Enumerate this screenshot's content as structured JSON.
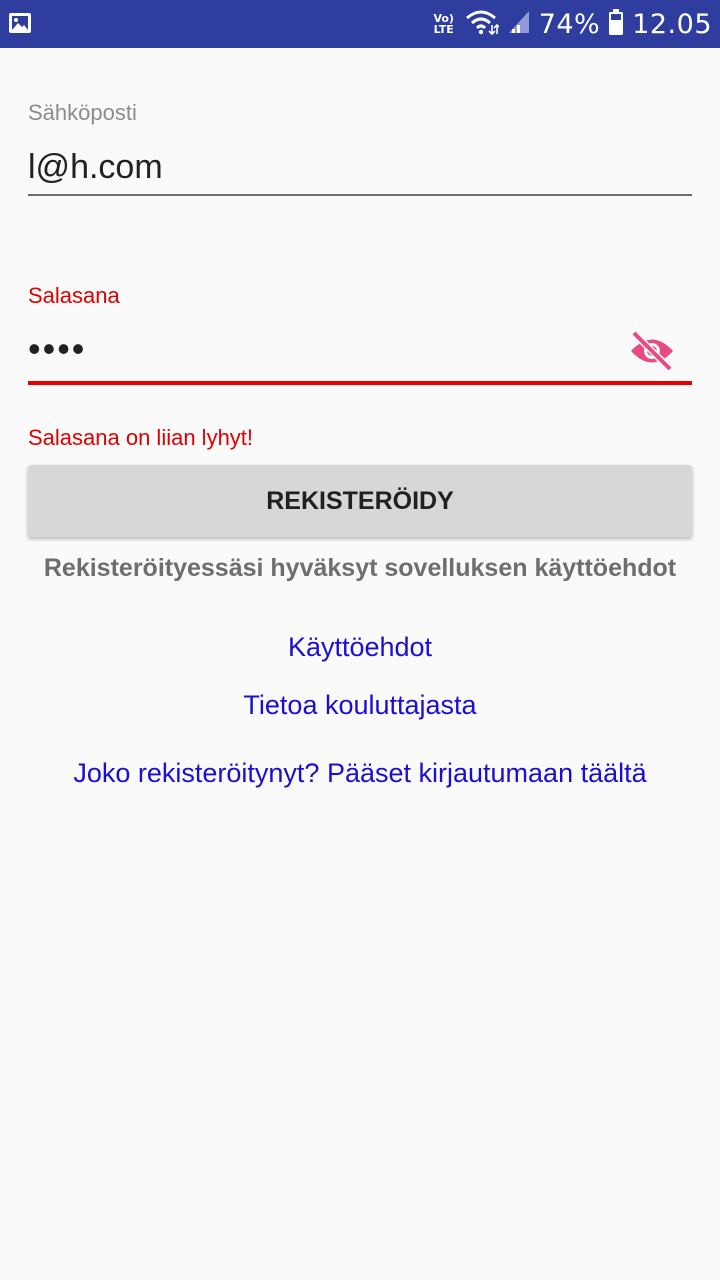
{
  "status_bar": {
    "volte_top": "Vo)",
    "volte_bottom": "LTE",
    "battery": "74%",
    "time": "12.05",
    "icons": [
      "gallery-icon",
      "wifi-icon",
      "signal-icon",
      "battery-icon"
    ]
  },
  "form": {
    "email_label": "Sähköposti",
    "email_value": "l@h.com",
    "password_label": "Salasana",
    "password_value": "••••",
    "password_error": "Salasana on liian lyhyt!",
    "register_button": "REKISTERÖIDY",
    "terms_note": "Rekisteröityessäsi hyväksyt sovelluksen käyttöehdot"
  },
  "links": {
    "terms": "Käyttöehdot",
    "trainer_info": "Tietoa kouluttajasta",
    "login": "Joko rekisteröitynyt? Pääset kirjautumaan täältä"
  },
  "colors": {
    "status_bar": "#2e3d9e",
    "error": "#e00000",
    "link": "#1a0ed4",
    "eye_icon": "#e84a84"
  }
}
